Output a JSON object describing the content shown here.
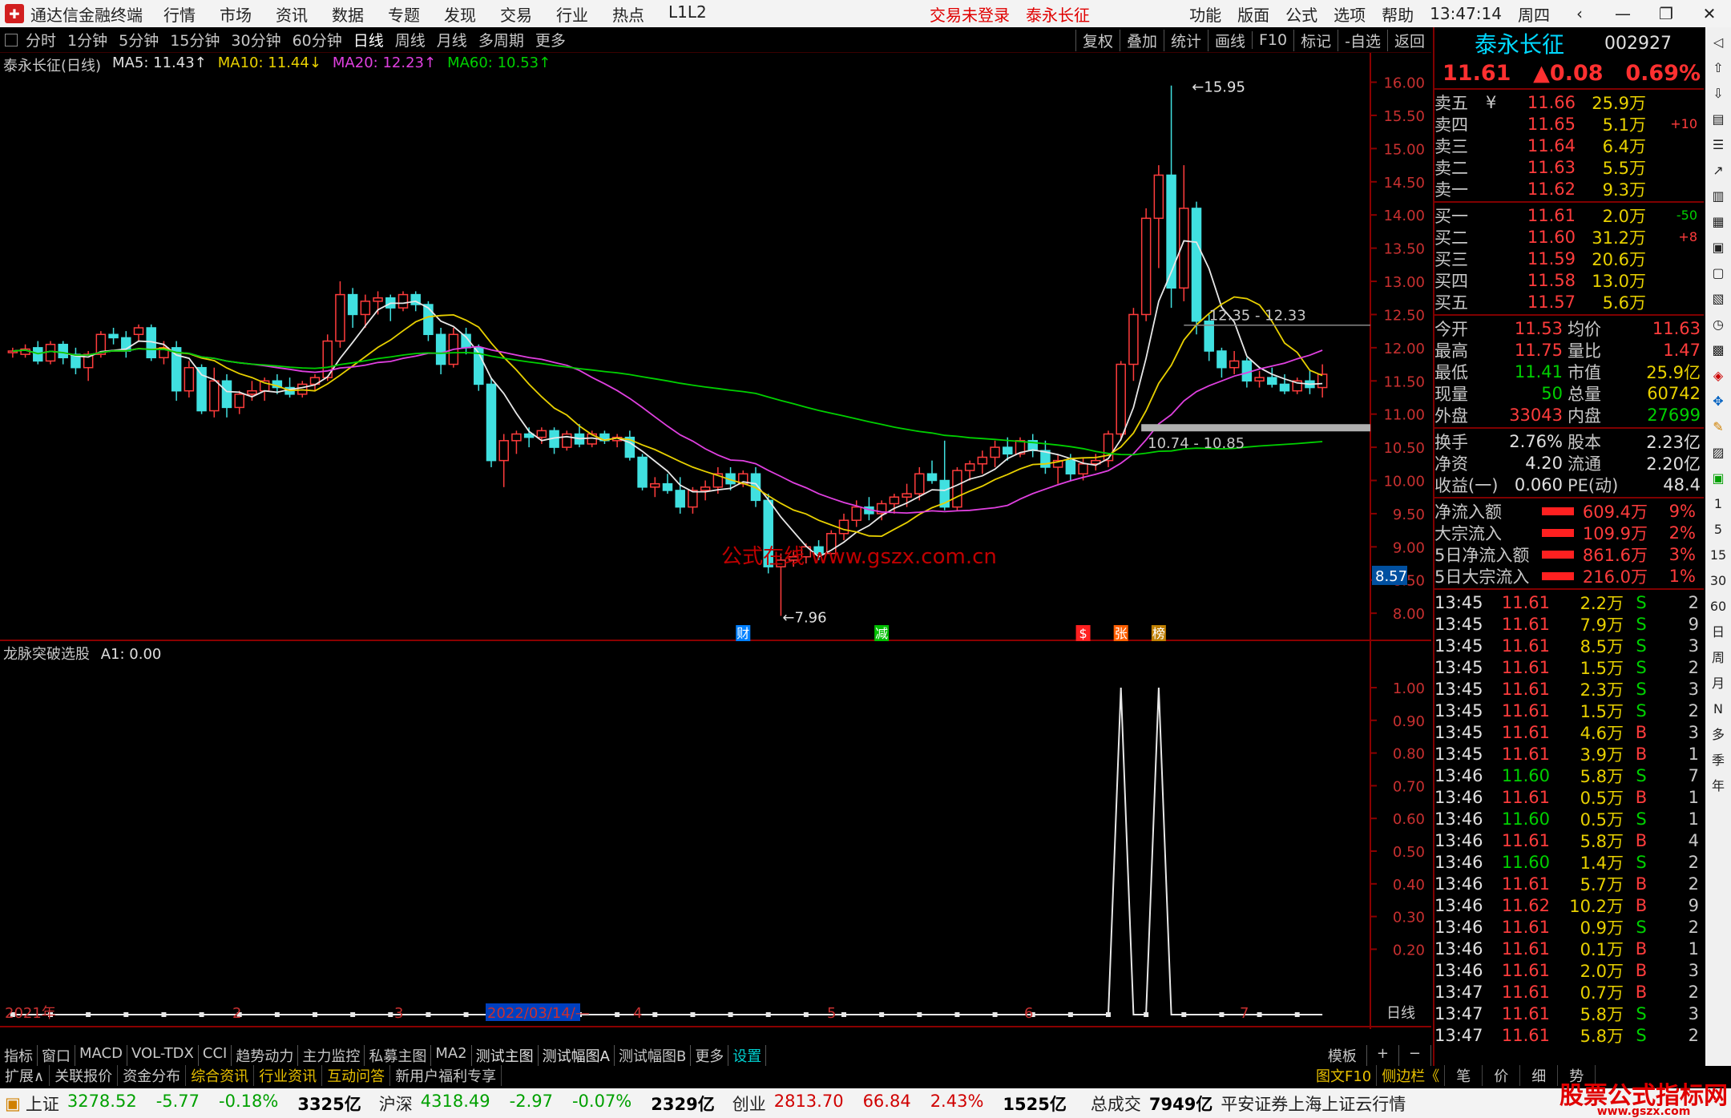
{
  "app": {
    "title": "通达信金融终端",
    "menu": [
      "行情",
      "市场",
      "资讯",
      "数据",
      "专题",
      "发现",
      "交易",
      "行业",
      "热点",
      "L1L2"
    ],
    "status_msg": "交易未登录",
    "stock_name_title": "泰永长征",
    "right_menu": [
      "功能",
      "版面",
      "公式",
      "选项",
      "帮助"
    ],
    "clock": "13:47:14",
    "weekday": "周四"
  },
  "periods": {
    "items": [
      "分时",
      "1分钟",
      "5分钟",
      "15分钟",
      "30分钟",
      "60分钟",
      "日线",
      "周线",
      "月线",
      "多周期",
      "更多"
    ],
    "active": "日线",
    "tools": [
      "复权",
      "叠加",
      "统计",
      "画线",
      "F10",
      "标记",
      "-自选",
      "返回"
    ]
  },
  "chart": {
    "title": "泰永长征(日线)",
    "ma_labels": [
      {
        "text": "MA5: 11.43↑",
        "color": "#e0e0e0"
      },
      {
        "text": "MA10: 11.44↓",
        "color": "#e8d000"
      },
      {
        "text": "MA20: 12.23↑",
        "color": "#e040e0"
      },
      {
        "text": "MA60: 10.53↑",
        "color": "#00d000"
      }
    ],
    "y_ticks": [
      "16.00",
      "15.50",
      "15.00",
      "14.50",
      "14.00",
      "13.50",
      "13.00",
      "12.50",
      "12.00",
      "11.50",
      "11.00",
      "10.50",
      "10.00",
      "9.50",
      "9.00",
      "8.50",
      "8.00"
    ],
    "ylim": [
      7.7,
      16.2
    ],
    "current_price": "8.57",
    "high_label": "15.95",
    "low_label": "7.96",
    "band_high": "12.35 - 12.33",
    "band_low": "10.74 - 10.85",
    "watermark": "公式在线 www.gszx.com.cn",
    "markers": [
      "财",
      "减",
      "$",
      "张",
      "榜"
    ],
    "x_labels": [
      "2021年",
      "2",
      "3",
      "2022/03/14/—",
      "4",
      "5",
      "6",
      "7"
    ],
    "bottom_right": "日线"
  },
  "indicator": {
    "title": "龙脉突破选股",
    "value": "A1: 0.00",
    "y_ticks": [
      "1.00",
      "0.90",
      "0.80",
      "0.70",
      "0.60",
      "0.50",
      "0.40",
      "0.30",
      "0.20"
    ]
  },
  "chart_data": {
    "type": "candlestick",
    "title": "泰永长征(日线)",
    "ylim": [
      7.7,
      16.2
    ],
    "ma": {
      "MA5": 11.43,
      "MA10": 11.44,
      "MA20": 12.23,
      "MA60": 10.53
    },
    "candles": [
      [
        11.95,
        12.0,
        11.85,
        11.95
      ],
      [
        11.9,
        12.05,
        11.85,
        11.98
      ],
      [
        12.0,
        12.1,
        11.75,
        11.8
      ],
      [
        11.8,
        12.1,
        11.75,
        12.05
      ],
      [
        12.05,
        12.1,
        11.75,
        11.85
      ],
      [
        11.9,
        12.0,
        11.6,
        11.7
      ],
      [
        11.7,
        11.95,
        11.5,
        11.9
      ],
      [
        11.9,
        12.25,
        11.85,
        12.2
      ],
      [
        12.2,
        12.3,
        12.05,
        12.15
      ],
      [
        12.15,
        12.25,
        11.85,
        11.95
      ],
      [
        12.2,
        12.35,
        12.1,
        12.3
      ],
      [
        12.3,
        12.35,
        11.8,
        11.85
      ],
      [
        11.85,
        12.1,
        11.75,
        12.0
      ],
      [
        12.0,
        12.1,
        11.2,
        11.35
      ],
      [
        11.35,
        11.8,
        11.25,
        11.7
      ],
      [
        11.7,
        11.75,
        11.0,
        11.05
      ],
      [
        11.05,
        11.7,
        10.95,
        11.5
      ],
      [
        11.5,
        11.6,
        10.95,
        11.1
      ],
      [
        11.1,
        11.35,
        11.0,
        11.3
      ],
      [
        11.3,
        11.5,
        11.2,
        11.35
      ],
      [
        11.35,
        11.55,
        11.2,
        11.5
      ],
      [
        11.5,
        11.6,
        11.3,
        11.4
      ],
      [
        11.4,
        11.55,
        11.25,
        11.3
      ],
      [
        11.3,
        11.5,
        11.25,
        11.45
      ],
      [
        11.45,
        11.6,
        11.35,
        11.55
      ],
      [
        11.55,
        12.2,
        11.5,
        12.1
      ],
      [
        12.1,
        13.0,
        12.0,
        12.8
      ],
      [
        12.8,
        12.9,
        12.3,
        12.5
      ],
      [
        12.5,
        12.8,
        12.3,
        12.7
      ],
      [
        12.7,
        12.85,
        12.5,
        12.75
      ],
      [
        12.75,
        12.8,
        12.4,
        12.6
      ],
      [
        12.6,
        12.85,
        12.55,
        12.8
      ],
      [
        12.8,
        12.85,
        12.55,
        12.65
      ],
      [
        12.65,
        12.7,
        12.1,
        12.2
      ],
      [
        12.2,
        12.3,
        11.6,
        11.75
      ],
      [
        11.75,
        12.3,
        11.7,
        12.2
      ],
      [
        12.2,
        12.3,
        11.9,
        12.0
      ],
      [
        12.0,
        12.05,
        11.35,
        11.45
      ],
      [
        11.45,
        11.55,
        10.2,
        10.3
      ],
      [
        10.3,
        10.7,
        9.9,
        10.6
      ],
      [
        10.6,
        10.75,
        10.4,
        10.7
      ],
      [
        10.7,
        10.8,
        10.5,
        10.65
      ],
      [
        10.65,
        10.8,
        10.55,
        10.75
      ],
      [
        10.75,
        10.8,
        10.4,
        10.5
      ],
      [
        10.5,
        10.75,
        10.45,
        10.7
      ],
      [
        10.7,
        10.85,
        10.5,
        10.55
      ],
      [
        10.55,
        10.75,
        10.5,
        10.7
      ],
      [
        10.7,
        10.75,
        10.55,
        10.6
      ],
      [
        10.6,
        10.7,
        10.5,
        10.65
      ],
      [
        10.65,
        10.75,
        10.3,
        10.35
      ],
      [
        10.35,
        10.4,
        9.85,
        9.9
      ],
      [
        9.9,
        10.05,
        9.75,
        9.95
      ],
      [
        9.95,
        10.1,
        9.8,
        9.85
      ],
      [
        9.85,
        10.05,
        9.5,
        9.6
      ],
      [
        9.6,
        9.9,
        9.5,
        9.85
      ],
      [
        9.85,
        10.0,
        9.7,
        9.9
      ],
      [
        9.9,
        10.2,
        9.8,
        10.1
      ],
      [
        10.1,
        10.2,
        9.85,
        9.95
      ],
      [
        9.95,
        10.15,
        9.9,
        10.1
      ],
      [
        10.1,
        10.2,
        9.6,
        9.7
      ],
      [
        9.7,
        9.8,
        8.6,
        8.7
      ],
      [
        8.7,
        8.9,
        7.96,
        8.8
      ],
      [
        8.8,
        8.95,
        8.7,
        8.85
      ],
      [
        8.85,
        9.05,
        8.75,
        9.0
      ],
      [
        9.0,
        9.1,
        8.8,
        8.9
      ],
      [
        8.9,
        9.25,
        8.85,
        9.2
      ],
      [
        9.2,
        9.5,
        9.1,
        9.4
      ],
      [
        9.4,
        9.7,
        9.3,
        9.6
      ],
      [
        9.6,
        9.75,
        9.4,
        9.5
      ],
      [
        9.5,
        9.7,
        9.4,
        9.65
      ],
      [
        9.65,
        9.8,
        9.5,
        9.75
      ],
      [
        9.75,
        9.95,
        9.6,
        9.8
      ],
      [
        9.8,
        10.2,
        9.7,
        10.1
      ],
      [
        10.1,
        10.3,
        9.95,
        10.0
      ],
      [
        10.0,
        10.6,
        9.55,
        9.6
      ],
      [
        9.6,
        10.2,
        9.55,
        10.15
      ],
      [
        10.15,
        10.3,
        10.0,
        10.25
      ],
      [
        10.25,
        10.45,
        10.1,
        10.35
      ],
      [
        10.35,
        10.6,
        10.2,
        10.5
      ],
      [
        10.5,
        10.65,
        10.3,
        10.4
      ],
      [
        10.4,
        10.65,
        10.35,
        10.6
      ],
      [
        10.6,
        10.7,
        10.35,
        10.45
      ],
      [
        10.45,
        10.6,
        10.1,
        10.2
      ],
      [
        10.2,
        10.4,
        9.95,
        10.3
      ],
      [
        10.3,
        10.4,
        10.0,
        10.1
      ],
      [
        10.1,
        10.35,
        10.0,
        10.25
      ],
      [
        10.25,
        10.4,
        10.15,
        10.3
      ],
      [
        10.3,
        10.75,
        10.2,
        10.7
      ],
      [
        10.7,
        11.8,
        10.6,
        11.75
      ],
      [
        11.75,
        12.6,
        11.5,
        12.5
      ],
      [
        12.5,
        14.1,
        12.4,
        13.95
      ],
      [
        13.95,
        14.75,
        13.2,
        14.6
      ],
      [
        14.6,
        15.95,
        12.6,
        12.9
      ],
      [
        12.9,
        14.75,
        12.7,
        14.1
      ],
      [
        14.1,
        14.2,
        12.2,
        12.4
      ],
      [
        12.4,
        12.5,
        11.8,
        11.95
      ],
      [
        11.95,
        12.0,
        11.55,
        11.7
      ],
      [
        11.7,
        11.95,
        11.6,
        11.8
      ],
      [
        11.8,
        11.85,
        11.4,
        11.5
      ],
      [
        11.5,
        11.65,
        11.4,
        11.55
      ],
      [
        11.55,
        11.7,
        11.4,
        11.45
      ],
      [
        11.45,
        11.6,
        11.3,
        11.35
      ],
      [
        11.35,
        11.55,
        11.3,
        11.5
      ],
      [
        11.5,
        11.65,
        11.3,
        11.4
      ],
      [
        11.4,
        11.75,
        11.25,
        11.6
      ]
    ],
    "indicator_A1": {
      "name": "龙脉突破选股",
      "values_at_spikes": [
        1.0,
        1.0
      ],
      "baseline": 0.0
    }
  },
  "quote": {
    "name": "泰永长征",
    "code": "002927",
    "price": "11.61",
    "change": "▲0.08",
    "pct": "0.69%",
    "asks": [
      {
        "l": "卖五",
        "y": "¥",
        "p": "11.66",
        "v": "25.9万",
        "d": ""
      },
      {
        "l": "卖四",
        "y": "",
        "p": "11.65",
        "v": "5.1万",
        "d": "+10"
      },
      {
        "l": "卖三",
        "y": "",
        "p": "11.64",
        "v": "6.4万",
        "d": ""
      },
      {
        "l": "卖二",
        "y": "",
        "p": "11.63",
        "v": "5.5万",
        "d": ""
      },
      {
        "l": "卖一",
        "y": "",
        "p": "11.62",
        "v": "9.3万",
        "d": ""
      }
    ],
    "bids": [
      {
        "l": "买一",
        "p": "11.61",
        "v": "2.0万",
        "d": "-50"
      },
      {
        "l": "买二",
        "p": "11.60",
        "v": "31.2万",
        "d": "+8"
      },
      {
        "l": "买三",
        "p": "11.59",
        "v": "20.6万",
        "d": ""
      },
      {
        "l": "买四",
        "p": "11.58",
        "v": "13.0万",
        "d": ""
      },
      {
        "l": "买五",
        "p": "11.57",
        "v": "5.6万",
        "d": ""
      }
    ],
    "stats": [
      [
        "今开",
        "11.53",
        "均价",
        "11.63"
      ],
      [
        "最高",
        "11.75",
        "量比",
        "1.47"
      ],
      [
        "最低",
        "11.41",
        "市值",
        "25.9亿"
      ],
      [
        "现量",
        "50",
        "总量",
        "60742"
      ],
      [
        "外盘",
        "33043",
        "内盘",
        "27699"
      ]
    ],
    "stats2": [
      [
        "换手",
        "2.76%",
        "股本",
        "2.23亿"
      ],
      [
        "净资",
        "4.20",
        "流通",
        "2.20亿"
      ],
      [
        "收益(一)",
        "0.060",
        "PE(动)",
        "48.4"
      ]
    ],
    "flows": [
      [
        "净流入额",
        "609.4万",
        "9%"
      ],
      [
        "大宗流入",
        "109.9万",
        "2%"
      ],
      [
        "5日净流入额",
        "861.6万",
        "3%"
      ],
      [
        "5日大宗流入",
        "216.0万",
        "1%"
      ]
    ],
    "ticks": [
      [
        "13:45",
        "11.61",
        "2.2万",
        "S",
        "2"
      ],
      [
        "13:45",
        "11.61",
        "7.9万",
        "S",
        "9"
      ],
      [
        "13:45",
        "11.61",
        "8.5万",
        "S",
        "3"
      ],
      [
        "13:45",
        "11.61",
        "1.5万",
        "S",
        "2"
      ],
      [
        "13:45",
        "11.61",
        "2.3万",
        "S",
        "3"
      ],
      [
        "13:45",
        "11.61",
        "1.5万",
        "S",
        "2"
      ],
      [
        "13:45",
        "11.61",
        "4.6万",
        "B",
        "3"
      ],
      [
        "13:45",
        "11.61",
        "3.9万",
        "B",
        "1"
      ],
      [
        "13:46",
        "11.60",
        "5.8万",
        "S",
        "7"
      ],
      [
        "13:46",
        "11.61",
        "0.5万",
        "B",
        "1"
      ],
      [
        "13:46",
        "11.60",
        "0.5万",
        "S",
        "1"
      ],
      [
        "13:46",
        "11.61",
        "5.8万",
        "B",
        "4"
      ],
      [
        "13:46",
        "11.60",
        "1.4万",
        "S",
        "2"
      ],
      [
        "13:46",
        "11.61",
        "5.7万",
        "B",
        "2"
      ],
      [
        "13:46",
        "11.62",
        "10.2万",
        "B",
        "9"
      ],
      [
        "13:46",
        "11.61",
        "0.9万",
        "S",
        "2"
      ],
      [
        "13:46",
        "11.61",
        "0.1万",
        "B",
        "1"
      ],
      [
        "13:46",
        "11.61",
        "2.0万",
        "B",
        "3"
      ],
      [
        "13:47",
        "11.61",
        "0.7万",
        "B",
        "2"
      ],
      [
        "13:47",
        "11.61",
        "5.8万",
        "S",
        "3"
      ],
      [
        "13:47",
        "11.61",
        "5.8万",
        "S",
        "2"
      ]
    ]
  },
  "sidetool": {
    "labels": [
      "1",
      "5",
      "15",
      "30",
      "60",
      "日",
      "周",
      "月",
      "N",
      "多",
      "季",
      "年"
    ]
  },
  "bottom": {
    "tabs": [
      "指标",
      "窗口",
      "MACD",
      "VOL-TDX",
      "CCI",
      "趋势动力",
      "主力监控",
      "私募主图",
      "MA2",
      "测试主图",
      "测试幅图A",
      "测试幅图B",
      "更多",
      "设置"
    ],
    "right": [
      "模板",
      "+",
      "−"
    ],
    "tabs2": [
      "扩展∧",
      "关联报价",
      "资金分布",
      "综合资讯",
      "行业资讯",
      "互动问答",
      "新用户福利专享"
    ],
    "tabs2_right": [
      "图文F10",
      "侧边栏《",
      "笔",
      "价",
      "细",
      "势"
    ]
  },
  "status": {
    "items": [
      {
        "name": "上证",
        "v": "3278.52",
        "c": "-5.77",
        "p": "-0.18%",
        "a": "3325亿"
      },
      {
        "name": "沪深",
        "v": "4318.49",
        "c": "-2.97",
        "p": "-0.07%",
        "a": "2329亿"
      },
      {
        "name": "创业",
        "v": "2813.70",
        "c": "66.84",
        "p": "2.43%",
        "a": "1525亿"
      }
    ],
    "total_label": "总成交",
    "total": "7949亿",
    "broker": "平安证券上海上证云行情",
    "watermark": "股票公式指标网",
    "watermark_url": "www.gszx.com"
  }
}
